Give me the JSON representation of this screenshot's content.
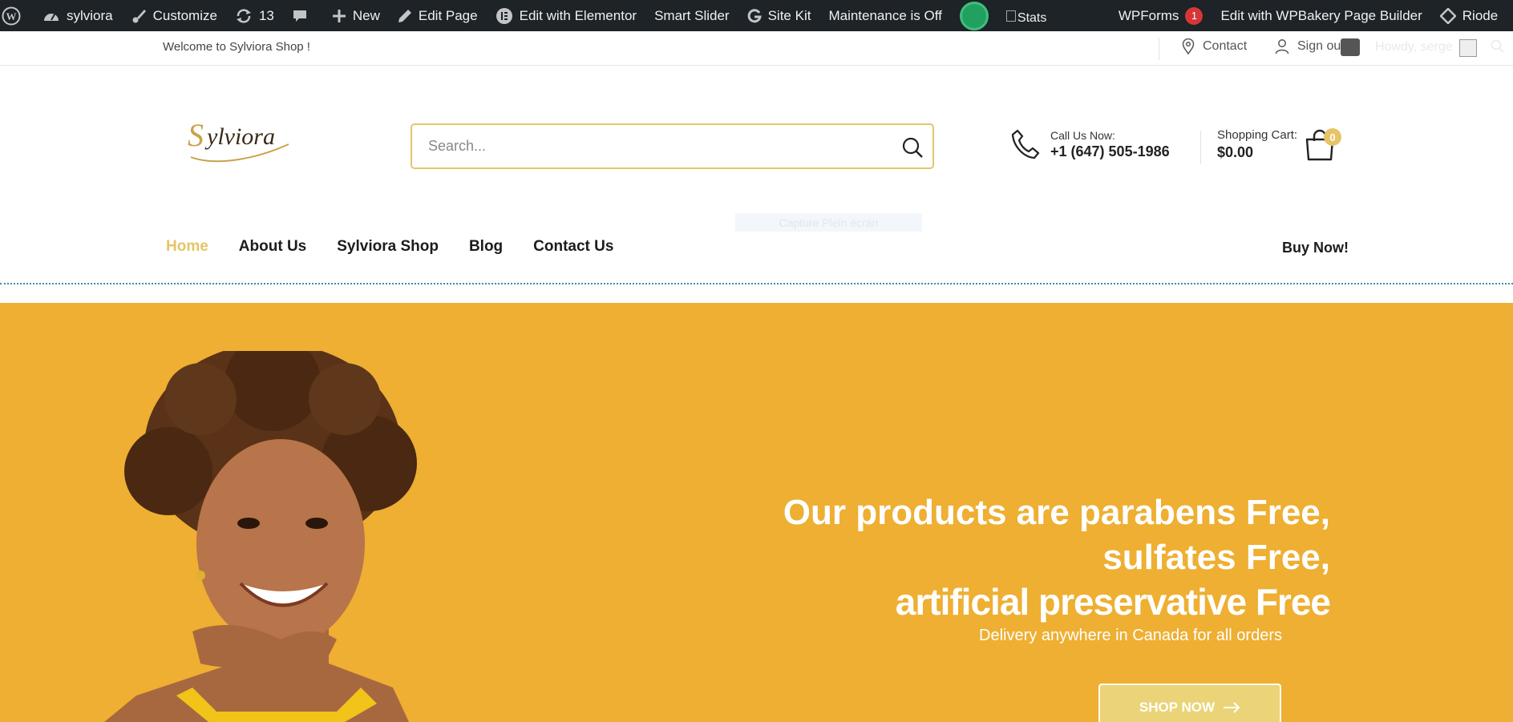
{
  "adminbar": {
    "site_name": "sylviora",
    "customize": "Customize",
    "updates_count": "13",
    "new": "New",
    "edit_page": "Edit Page",
    "edit_elementor": "Edit with Elementor",
    "smart_slider": "Smart Slider",
    "site_kit": "Site Kit",
    "maintenance": "Maintenance is Off",
    "stats": "Stats",
    "wpforms": "WPForms",
    "wpforms_count": "1",
    "wpbakery": "Edit with WPBakery Page Builder",
    "riode": "Riode"
  },
  "topbar": {
    "welcome": "Welcome to Sylviora Shop !",
    "contact": "Contact",
    "signout": "Sign ou",
    "howdy": "Howdy, serge"
  },
  "header": {
    "logo_text": "Sylviora",
    "search_placeholder": "Search...",
    "call_label": "Call Us Now:",
    "call_number": "+1 (647) 505-1986",
    "cart_label": "Shopping Cart:",
    "cart_total": "$0.00",
    "cart_count": "0",
    "capture": "Capture Plein écran"
  },
  "nav": {
    "items": [
      {
        "label": "Home"
      },
      {
        "label": "About Us"
      },
      {
        "label": "Sylviora Shop"
      },
      {
        "label": "Blog"
      },
      {
        "label": "Contact Us"
      }
    ],
    "buy_now": "Buy Now!"
  },
  "hero": {
    "line1": "Our products are parabens Free,",
    "line2": "sulfates Free,",
    "line3": "artificial preservative Free",
    "subline": "Delivery anywhere in Canada for all orders",
    "button": "SHOP NOW"
  },
  "colors": {
    "accent": "#e5c568",
    "hero_bg": "#eeaf32",
    "adminbar_bg": "#1d2327"
  }
}
